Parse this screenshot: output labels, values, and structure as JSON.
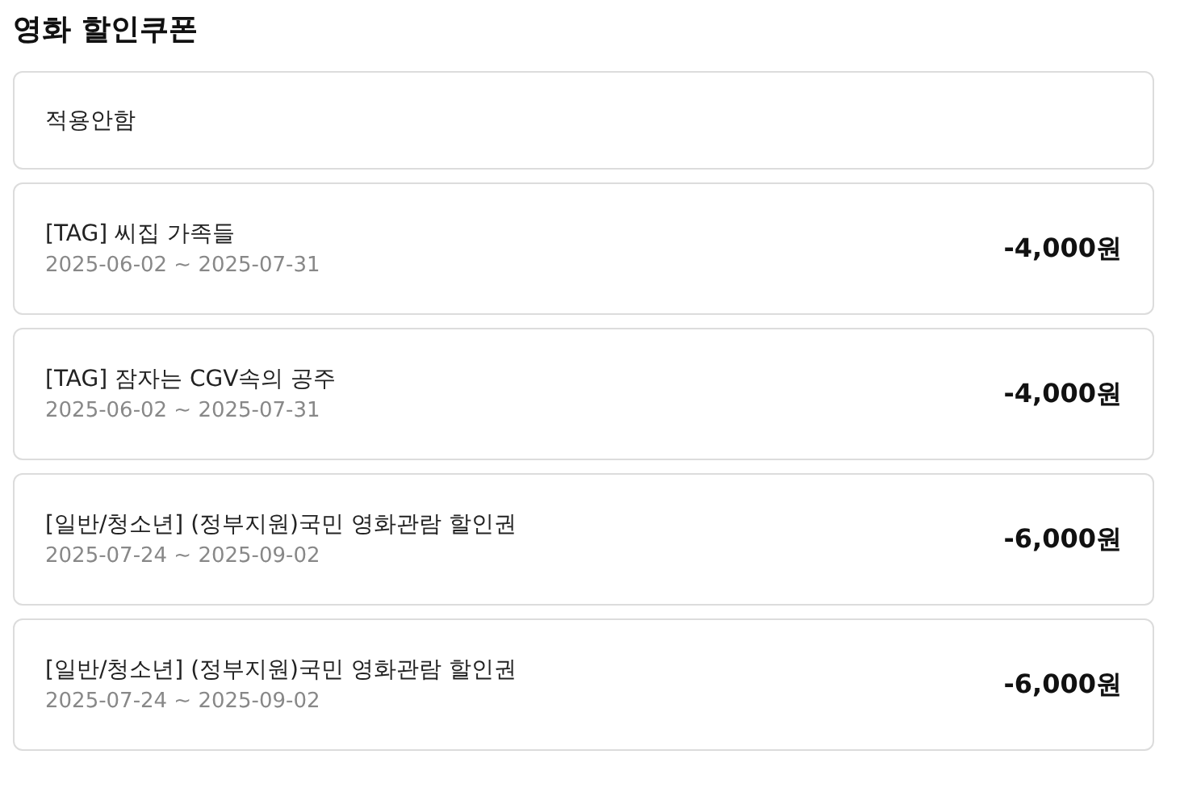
{
  "title": "영화 할인쿠폰",
  "options": [
    {
      "kind": "none",
      "label": "적용안함"
    },
    {
      "kind": "coupon",
      "name": "[TAG] 씨집 가족들",
      "period": "2025-06-02 ~ 2025-07-31",
      "discount": "-4,000원"
    },
    {
      "kind": "coupon",
      "name": "[TAG] 잠자는 CGV속의 공주",
      "period": "2025-06-02 ~ 2025-07-31",
      "discount": "-4,000원"
    },
    {
      "kind": "coupon",
      "name": "[일반/청소년] (정부지원)국민 영화관람 할인권",
      "period": "2025-07-24 ~ 2025-09-02",
      "discount": "-6,000원"
    },
    {
      "kind": "coupon",
      "name": "[일반/청소년] (정부지원)국민 영화관람 할인권",
      "period": "2025-07-24 ~ 2025-09-02",
      "discount": "-6,000원"
    }
  ]
}
